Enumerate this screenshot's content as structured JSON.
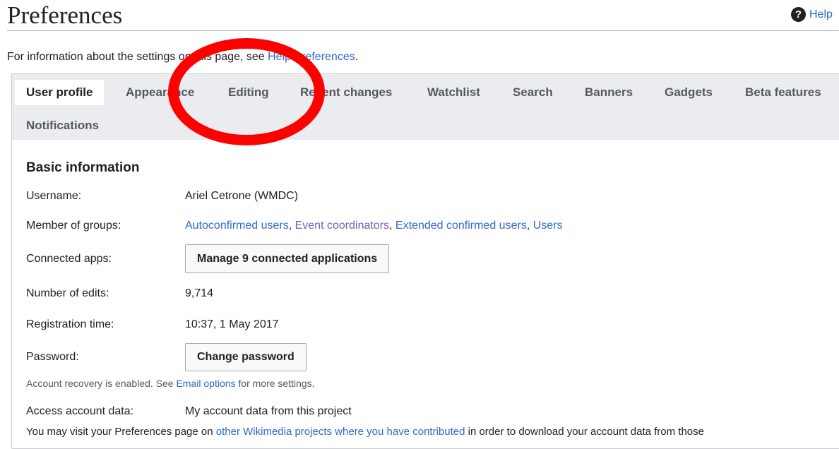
{
  "header": {
    "title": "Preferences",
    "help_label": "Help"
  },
  "intro": {
    "prefix": "For information about the settings on this page, see ",
    "link": "Help:Preferences",
    "suffix": "."
  },
  "tabs": [
    {
      "label": "User profile",
      "active": true
    },
    {
      "label": "Appearance"
    },
    {
      "label": "Editing"
    },
    {
      "label": "Recent changes"
    },
    {
      "label": "Watchlist"
    },
    {
      "label": "Search"
    },
    {
      "label": "Banners"
    },
    {
      "label": "Gadgets"
    },
    {
      "label": "Beta features"
    },
    {
      "label": "Notifications"
    }
  ],
  "basic": {
    "section_title": "Basic information",
    "username_label": "Username:",
    "username_value": "Ariel Cetrone (WMDC)",
    "groups_label": "Member of groups:",
    "groups": [
      "Autoconfirmed users",
      "Event coordinators",
      "Extended confirmed users",
      "Users"
    ],
    "groups_separator": ", ",
    "apps_label": "Connected apps:",
    "apps_button": "Manage 9 connected applications",
    "edits_label": "Number of edits:",
    "edits_value": "9,714",
    "registration_label": "Registration time:",
    "registration_value": "10:37, 1 May 2017",
    "password_label": "Password:",
    "password_button": "Change password",
    "recovery_prefix": "Account recovery is enabled. See ",
    "recovery_link": "Email options",
    "recovery_suffix": " for more settings.",
    "access_label": "Access account data:",
    "access_link": "My account data from this project",
    "visit_prefix": "You may visit your Preferences page on ",
    "visit_link": "other Wikimedia projects where you have contributed",
    "visit_suffix": " in order to download your account data from those"
  },
  "annotation": {
    "shape": "circle",
    "color": "#ff0000",
    "target": "Editing"
  },
  "colors": {
    "link": "#3366cc",
    "visited_link": "#795cb2",
    "tabbar": "#eaecf0"
  }
}
